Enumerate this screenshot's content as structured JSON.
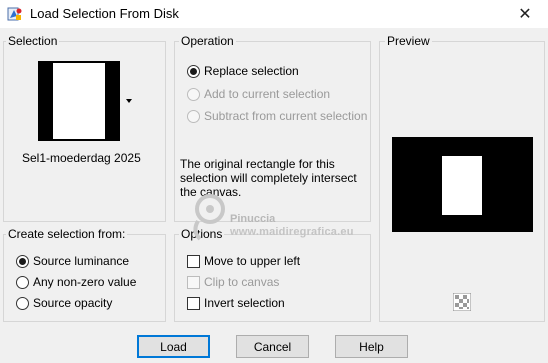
{
  "window": {
    "title": "Load Selection From Disk",
    "close_glyph": "✕",
    "app_icon": "app-icon"
  },
  "selection_group": {
    "label": "Selection",
    "filename": "Sel1-moederdag 2025",
    "dropdown_icon": "triangle-down-icon"
  },
  "operation_group": {
    "label": "Operation",
    "options": [
      {
        "label": "Replace selection",
        "checked": true,
        "enabled": true
      },
      {
        "label": "Add to current selection",
        "checked": false,
        "enabled": false
      },
      {
        "label": "Subtract from current selection",
        "checked": false,
        "enabled": false
      }
    ],
    "description": "The original rectangle for this selection will completely intersect the canvas."
  },
  "preview_group": {
    "label": "Preview",
    "checker_icon": "transparency-checker-icon"
  },
  "create_from_group": {
    "label": "Create selection from:",
    "options": [
      {
        "label": "Source luminance",
        "checked": true
      },
      {
        "label": "Any non-zero value",
        "checked": false
      },
      {
        "label": "Source opacity",
        "checked": false
      }
    ]
  },
  "options_group": {
    "label": "Options",
    "items": [
      {
        "label": "Move to upper left",
        "checked": false,
        "enabled": true
      },
      {
        "label": "Clip to canvas",
        "checked": false,
        "enabled": false
      },
      {
        "label": "Invert selection",
        "checked": false,
        "enabled": true
      }
    ]
  },
  "watermark": {
    "name": "Pinuccia",
    "url": "www.maidiregrafica.eu"
  },
  "buttons": {
    "load": "Load",
    "cancel": "Cancel",
    "help": "Help"
  }
}
